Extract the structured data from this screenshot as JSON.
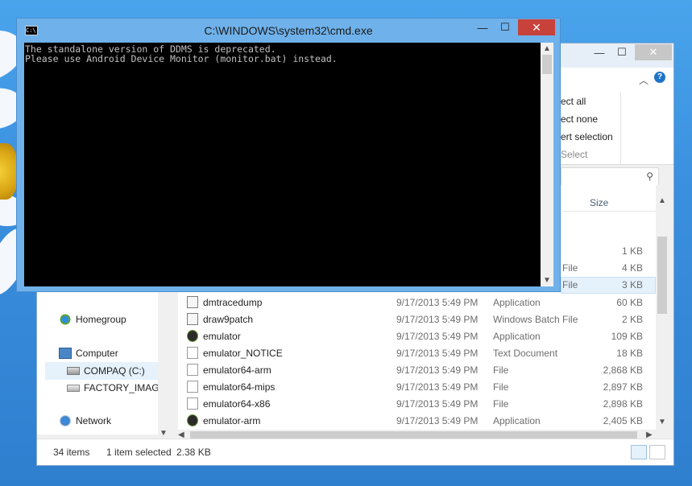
{
  "cmd": {
    "title": "C:\\WINDOWS\\system32\\cmd.exe",
    "icon_text": "C:\\",
    "buttons": {
      "minimize": "—",
      "maximize": "☐",
      "close": "✕"
    },
    "console_lines": [
      "The standalone version of DDMS is deprecated.",
      "Please use Android Device Monitor (monitor.bat) instead."
    ]
  },
  "explorer": {
    "buttons": {
      "minimize": "—",
      "maximize": "☐",
      "close": "✕"
    },
    "ribbon": {
      "select_all": "ect all",
      "select_none": "ect none",
      "invert_selection": "ert selection",
      "group_label": "Select"
    },
    "header": {
      "size": "Size"
    },
    "partial_rows": [
      {
        "type": "",
        "size": "1 KB"
      },
      {
        "type": "File",
        "size": "4 KB"
      },
      {
        "type": "File",
        "size": "3 KB"
      }
    ],
    "nav": {
      "homegroup": "Homegroup",
      "computer": "Computer",
      "compaq": "COMPAQ (C:)",
      "factory": "FACTORY_IMAGE",
      "network": "Network"
    },
    "files": [
      {
        "name": "dmtracedump",
        "date": "9/17/2013 5:49 PM",
        "type": "Application",
        "size": "60 KB",
        "icon": "app-window-icon"
      },
      {
        "name": "draw9patch",
        "date": "9/17/2013 5:49 PM",
        "type": "Windows Batch File",
        "size": "2 KB",
        "icon": "batch-file-icon"
      },
      {
        "name": "emulator",
        "date": "9/17/2013 5:49 PM",
        "type": "Application",
        "size": "109 KB",
        "icon": "android-app-icon"
      },
      {
        "name": "emulator_NOTICE",
        "date": "9/17/2013 5:49 PM",
        "type": "Text Document",
        "size": "18 KB",
        "icon": "text-file-icon"
      },
      {
        "name": "emulator64-arm",
        "date": "9/17/2013 5:49 PM",
        "type": "File",
        "size": "2,868 KB",
        "icon": "file-icon"
      },
      {
        "name": "emulator64-mips",
        "date": "9/17/2013 5:49 PM",
        "type": "File",
        "size": "2,897 KB",
        "icon": "file-icon"
      },
      {
        "name": "emulator64-x86",
        "date": "9/17/2013 5:49 PM",
        "type": "File",
        "size": "2,898 KB",
        "icon": "file-icon"
      },
      {
        "name": "emulator-arm",
        "date": "9/17/2013 5:49 PM",
        "type": "Application",
        "size": "2,405 KB",
        "icon": "android-app-icon"
      }
    ],
    "status": {
      "item_count": "34 items",
      "selection": "1 item selected",
      "selection_size": "2.38 KB"
    }
  }
}
